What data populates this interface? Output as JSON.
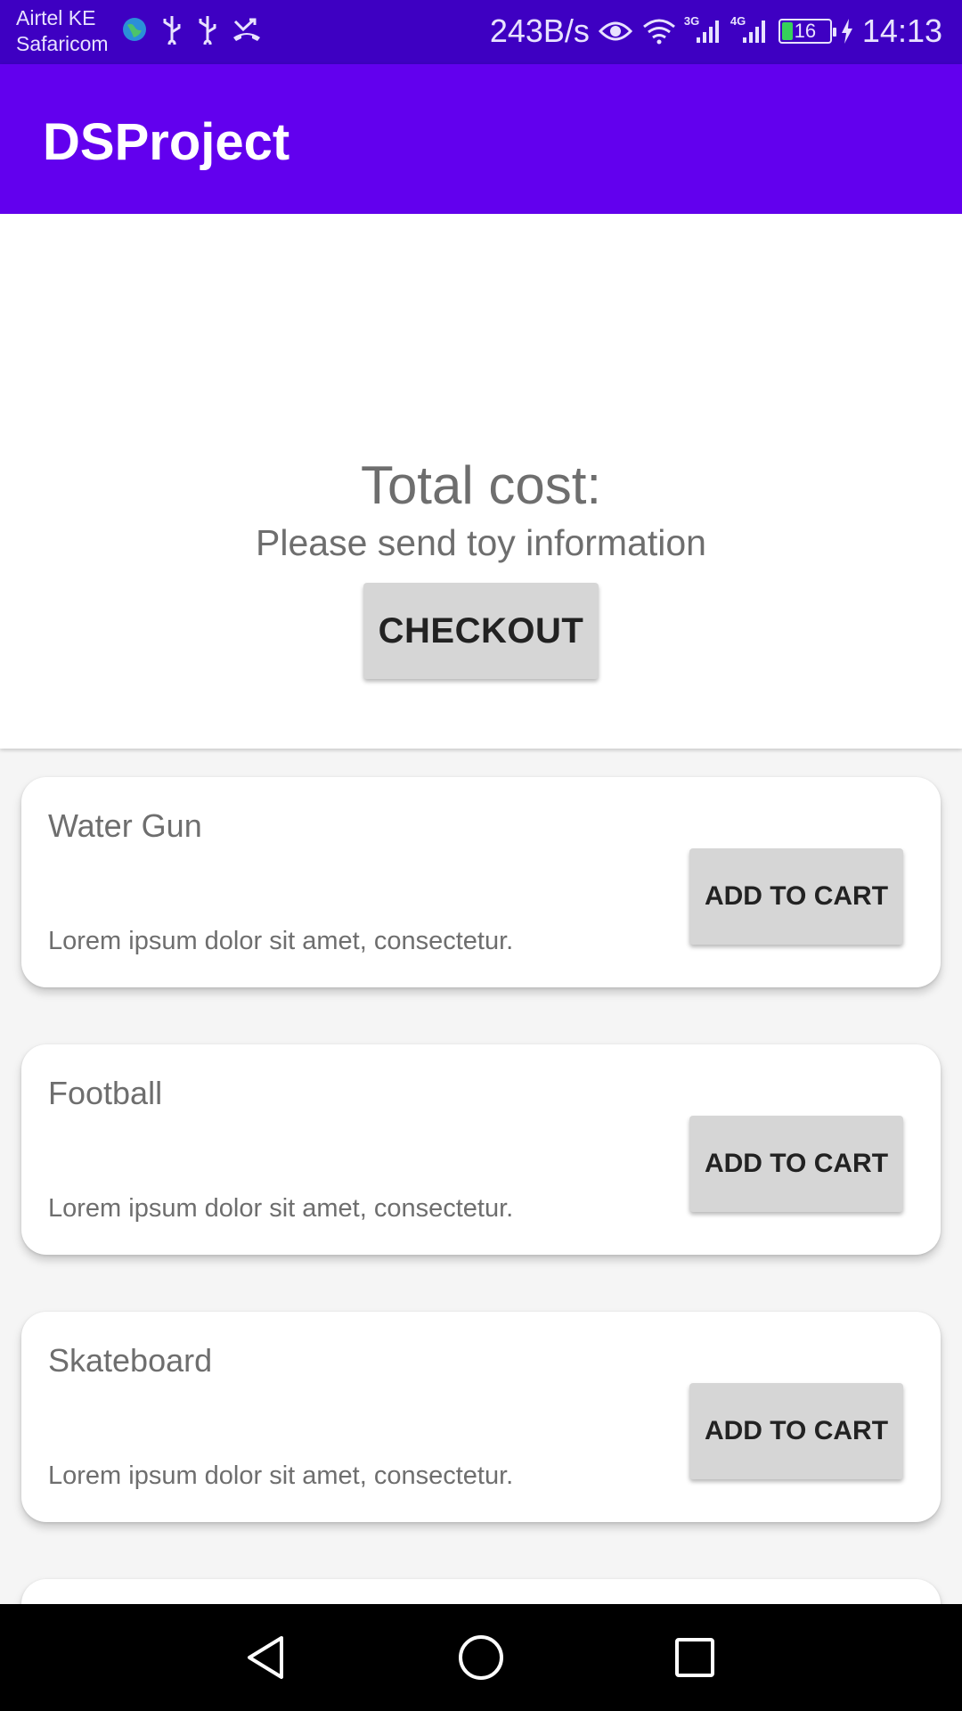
{
  "status_bar": {
    "carrier_1": "Airtel KE",
    "carrier_2": "Safaricom",
    "net_speed": "243B/s",
    "network_3g": "3G",
    "network_4g": "4G",
    "battery_level": "16",
    "time": "14:13",
    "icons": [
      "globe-icon",
      "usb-icon",
      "usb-icon",
      "missed-call-icon",
      "eye-icon",
      "wifi-icon",
      "signal-icon",
      "signal-icon",
      "battery-icon",
      "charging-icon"
    ]
  },
  "app_bar": {
    "title": "DSProject",
    "color": "#6200ee"
  },
  "summary": {
    "total_label": "Total cost:",
    "toy_info": "Please send toy information",
    "checkout_label": "CHECKOUT"
  },
  "items": [
    {
      "name": "Water Gun",
      "description": "Lorem ipsum dolor sit amet, consectetur.",
      "button": "ADD TO CART"
    },
    {
      "name": "Football",
      "description": "Lorem ipsum dolor sit amet, consectetur.",
      "button": "ADD TO CART"
    },
    {
      "name": "Skateboard",
      "description": "Lorem ipsum dolor sit amet, consectetur.",
      "button": "ADD TO CART"
    }
  ],
  "nav_bar": {
    "icons": [
      "back-icon",
      "home-icon",
      "recents-icon"
    ]
  }
}
